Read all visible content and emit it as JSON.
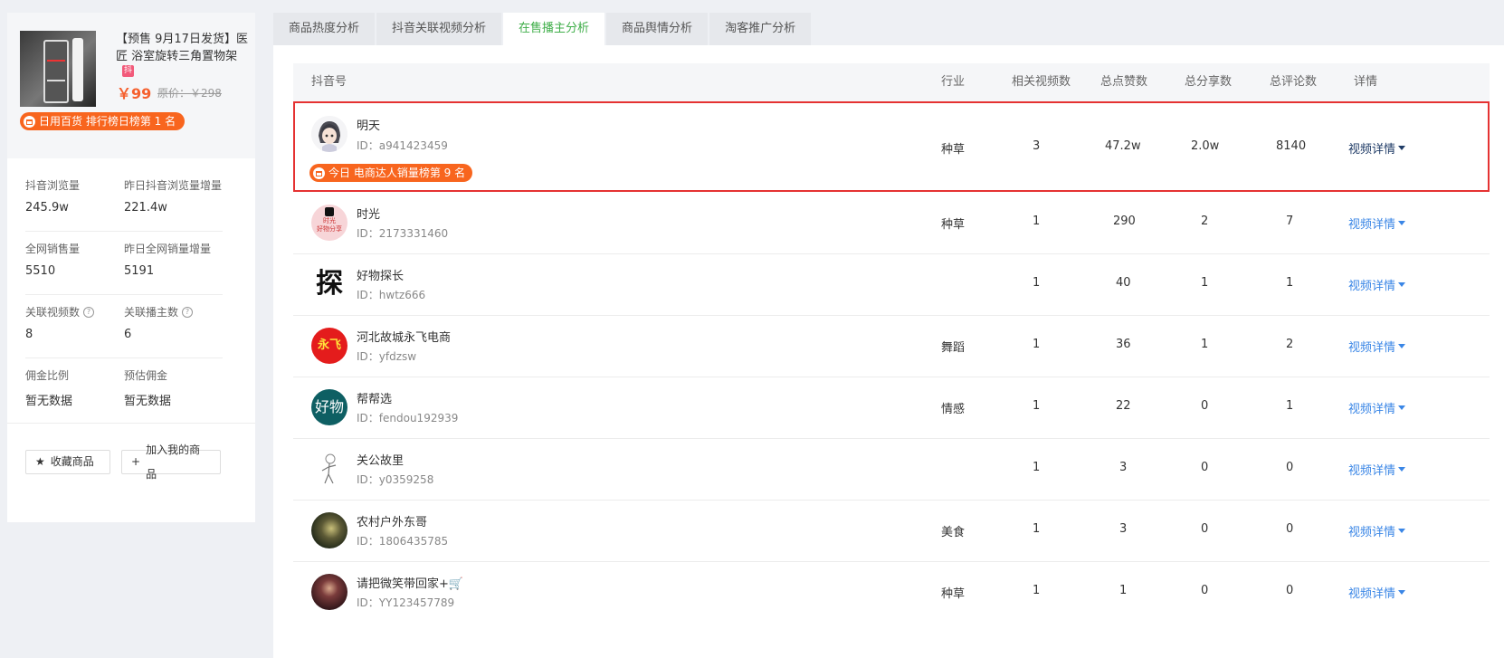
{
  "product": {
    "title": "【预售 9月17日发货】医匠 浴室旋转三角置物架",
    "platform_badge": "抖",
    "price": "￥99",
    "original_price": "原价：￥298",
    "rank_badge": "日用百货 排行榜日榜第 1 名",
    "accent_color": "#f5602e",
    "badge_color": "#f8651e"
  },
  "stats": [
    {
      "label": "抖音浏览量",
      "value": "245.9w"
    },
    {
      "label": "昨日抖音浏览量增量",
      "value": "221.4w"
    },
    {
      "label": "全网销售量",
      "value": "5510"
    },
    {
      "label": "昨日全网销量增量",
      "value": "5191"
    },
    {
      "label": "关联视频数",
      "value": "8",
      "help": "?"
    },
    {
      "label": "关联播主数",
      "value": "6",
      "help": "?"
    },
    {
      "label": "佣金比例",
      "value": "暂无数据"
    },
    {
      "label": "预估佣金",
      "value": "暂无数据"
    }
  ],
  "buttons": {
    "favorite": "收藏商品",
    "favorite_icon": "★",
    "add": "加入我的商品",
    "add_icon": "+"
  },
  "tabs": [
    {
      "label": "商品热度分析",
      "active": false
    },
    {
      "label": "抖音关联视频分析",
      "active": false
    },
    {
      "label": "在售播主分析",
      "active": true
    },
    {
      "label": "商品舆情分析",
      "active": false
    },
    {
      "label": "淘客推广分析",
      "active": false
    }
  ],
  "table": {
    "headers": {
      "account": "抖音号",
      "industry": "行业",
      "videos": "相关视频数",
      "likes": "总点赞数",
      "shares": "总分享数",
      "comments": "总评论数",
      "detail": "详情"
    },
    "rows": [
      {
        "name": "明天",
        "id": "ID：a941423459",
        "industry": "种草",
        "videos": "3",
        "likes": "47.2w",
        "shares": "2.0w",
        "comments": "8140",
        "detail": "视频详情",
        "badge": "今日 电商达人销量榜第 9 名",
        "highlighted": true,
        "avatar": "anime-avatar"
      },
      {
        "name": "时光",
        "id": "ID：2173331460",
        "industry": "种草",
        "videos": "1",
        "likes": "290",
        "shares": "2",
        "comments": "7",
        "detail": "视频详情",
        "avatar_text": "时光\n好物分享",
        "avatar": "tiktok-avatar"
      },
      {
        "name": "好物探长",
        "id": "ID：hwtz666",
        "industry": "",
        "videos": "1",
        "likes": "40",
        "shares": "1",
        "comments": "1",
        "detail": "视频详情",
        "avatar_text": "探",
        "avatar": "text-avatar"
      },
      {
        "name": "河北故城永飞电商",
        "id": "ID：yfdzsw",
        "industry": "舞蹈",
        "videos": "1",
        "likes": "36",
        "shares": "1",
        "comments": "2",
        "detail": "视频详情",
        "avatar_text": "永飞",
        "avatar": "logo-avatar"
      },
      {
        "name": "帮帮选",
        "id": "ID：fendou192939",
        "industry": "情感",
        "videos": "1",
        "likes": "22",
        "shares": "0",
        "comments": "1",
        "detail": "视频详情",
        "avatar_text": "好物",
        "avatar": "teal-avatar"
      },
      {
        "name": "关公故里",
        "id": "ID：y0359258",
        "industry": "",
        "videos": "1",
        "likes": "3",
        "shares": "0",
        "comments": "0",
        "detail": "视频详情",
        "avatar": "sketch-avatar"
      },
      {
        "name": "农村户外东哥",
        "id": "ID：1806435785",
        "industry": "美食",
        "videos": "1",
        "likes": "3",
        "shares": "0",
        "comments": "0",
        "detail": "视频详情",
        "avatar": "photo-avatar"
      },
      {
        "name": "请把微笑带回家+🛒",
        "id": "ID：YY123457789",
        "industry": "种草",
        "videos": "1",
        "likes": "1",
        "shares": "0",
        "comments": "0",
        "detail": "视频详情",
        "avatar": "portrait-avatar"
      }
    ]
  },
  "colors": {
    "active_tab": "#3fae49",
    "link": "#3a86e6",
    "highlight_border": "#e53232"
  }
}
